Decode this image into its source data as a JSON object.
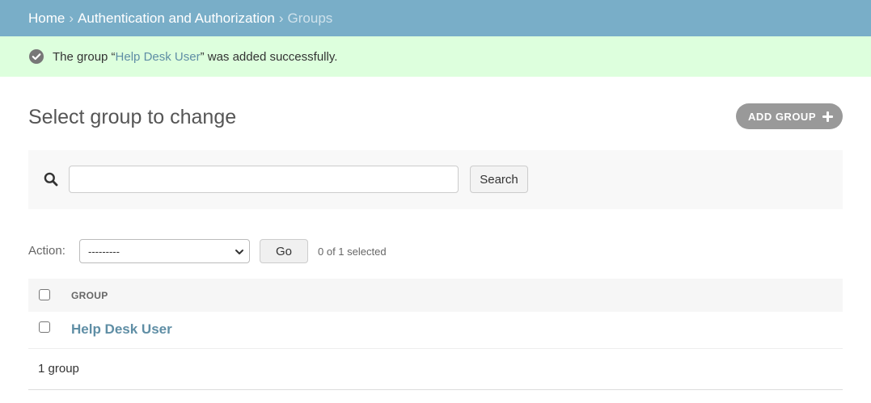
{
  "breadcrumbs": {
    "home": "Home",
    "app": "Authentication and Authorization",
    "current": "Groups",
    "separator": "›"
  },
  "message": {
    "prefix": "The group “",
    "link": "Help Desk User",
    "suffix": "” was added successfully.",
    "icon": "success-check-icon"
  },
  "page": {
    "title": "Select group to change",
    "add_button": "ADD GROUP"
  },
  "search": {
    "value": "",
    "placeholder": "",
    "button": "Search"
  },
  "actions": {
    "label": "Action:",
    "selected_option": "---------",
    "go_button": "Go",
    "selection_count": "0 of 1 selected"
  },
  "table": {
    "column_header": "GROUP",
    "rows": [
      {
        "name": "Help Desk User"
      }
    ]
  },
  "paginator": {
    "text": "1 group"
  },
  "colors": {
    "header": "#79aec8",
    "success": "#dfd",
    "link": "#5f8ea5"
  }
}
